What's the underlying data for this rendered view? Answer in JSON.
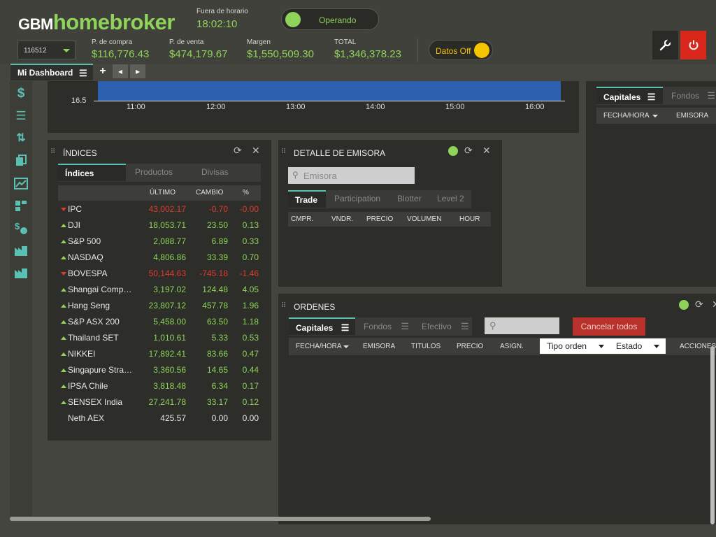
{
  "header": {
    "logo_prefix": "GBM",
    "logo_main": "homebroker",
    "market_status_label": "Fuera de horario",
    "market_time": "18:02:10",
    "operando_label": "Operando",
    "account": "116512",
    "metrics": [
      {
        "label": "P. de compra",
        "value": "$116,776.43"
      },
      {
        "label": "P. de venta",
        "value": "$474,179.67"
      },
      {
        "label": "Margen",
        "value": "$1,550,509.30"
      },
      {
        "label": "TOTAL",
        "value": "$1,346,378.23"
      }
    ],
    "datos_label": "Datos Off"
  },
  "tabs": {
    "dashboard": "Mi Dashboard",
    "add": "+",
    "prev": "◂",
    "next": "▸"
  },
  "chart": {
    "ytick": "16.5",
    "xticks": [
      "11:00",
      "12:00",
      "13:00",
      "14:00",
      "15:00",
      "16:00"
    ]
  },
  "indices": {
    "title": "ÍNDICES",
    "tabs": [
      "Índices",
      "Productos",
      "Divisas"
    ],
    "columns": [
      "ÚLTIMO",
      "CAMBIO",
      "%"
    ],
    "rows": [
      {
        "name": "IPC",
        "last": "43,002.17",
        "change": "-0.70",
        "pct": "-0.00",
        "dir": "down"
      },
      {
        "name": "DJI",
        "last": "18,053.71",
        "change": "23.50",
        "pct": "0.13",
        "dir": "up"
      },
      {
        "name": "S&P 500",
        "last": "2,088.77",
        "change": "6.89",
        "pct": "0.33",
        "dir": "up"
      },
      {
        "name": "NASDAQ",
        "last": "4,806.86",
        "change": "33.39",
        "pct": "0.70",
        "dir": "up"
      },
      {
        "name": "BOVESPA",
        "last": "50,144.63",
        "change": "-745.18",
        "pct": "-1.46",
        "dir": "down"
      },
      {
        "name": "Shangai Comp…",
        "last": "3,197.02",
        "change": "124.48",
        "pct": "4.05",
        "dir": "up"
      },
      {
        "name": "Hang Seng",
        "last": "23,807.12",
        "change": "457.78",
        "pct": "1.96",
        "dir": "up"
      },
      {
        "name": "S&P ASX 200",
        "last": "5,458.00",
        "change": "63.50",
        "pct": "1.18",
        "dir": "up"
      },
      {
        "name": "Thailand SET",
        "last": "1,010.61",
        "change": "5.33",
        "pct": "0.53",
        "dir": "up"
      },
      {
        "name": "NIKKEI",
        "last": "17,892.41",
        "change": "83.66",
        "pct": "0.47",
        "dir": "up"
      },
      {
        "name": "Singapure Stra…",
        "last": "3,360.56",
        "change": "14.65",
        "pct": "0.44",
        "dir": "up"
      },
      {
        "name": "IPSA Chile",
        "last": "3,818.48",
        "change": "6.34",
        "pct": "0.17",
        "dir": "up"
      },
      {
        "name": "SENSEX India",
        "last": "27,241.78",
        "change": "33.17",
        "pct": "0.12",
        "dir": "up"
      },
      {
        "name": "Neth AEX",
        "last": "425.57",
        "change": "0.00",
        "pct": "0.00",
        "dir": "none"
      }
    ]
  },
  "detalle": {
    "title": "DETALLE DE EMISORA",
    "search_placeholder": "Emisora",
    "tabs": [
      "Trade",
      "Participation",
      "Blotter",
      "Level 2"
    ],
    "columns": [
      "CMPR.",
      "VNDR.",
      "PRECIO",
      "VOLUMEN",
      "HOUR"
    ]
  },
  "right_panel": {
    "tabs": [
      "Capitales",
      "Fondos"
    ],
    "columns": [
      "FECHA/HORA",
      "EMISORA"
    ]
  },
  "ordenes": {
    "title": "ORDENES",
    "tabs": [
      "Capitales",
      "Fondos",
      "Efectivo"
    ],
    "cancel_label": "Cancelar todos",
    "columns": [
      "FECHA/HORA",
      "EMISORA",
      "TITULOS",
      "PRECIO",
      "ASIGN."
    ],
    "tipo_orden": "Tipo orden",
    "estado": "Estado",
    "acciones": "ACCIONES"
  },
  "colors": {
    "accent_green": "#8ed35a",
    "teal": "#5bc0b4",
    "red": "#e03b2d",
    "power_red": "#d9271c",
    "yellow": "#f5c400"
  }
}
